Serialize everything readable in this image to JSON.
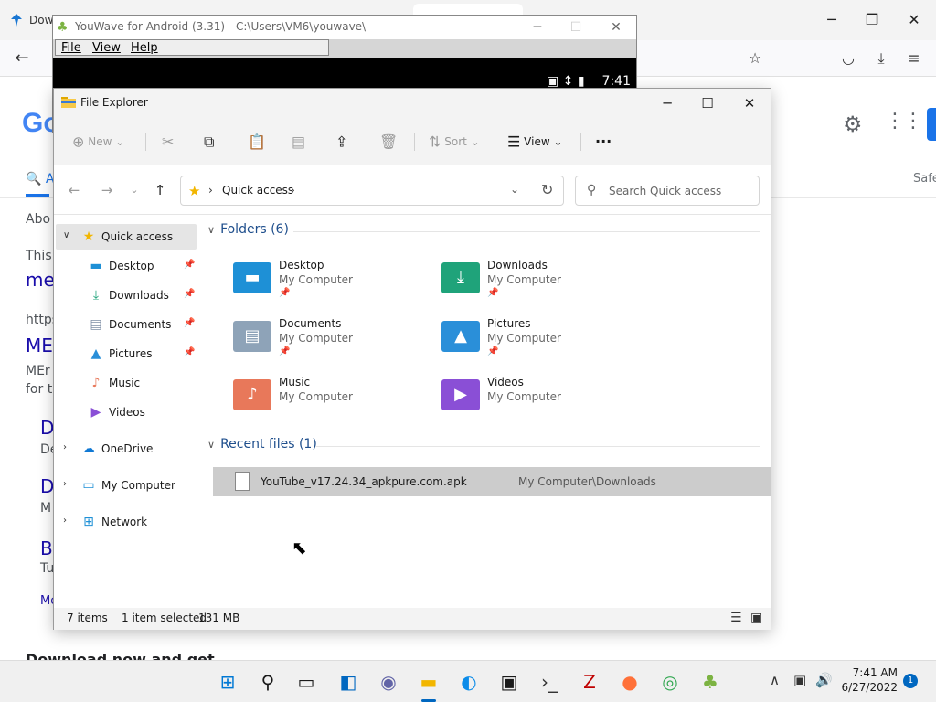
{
  "browser": {
    "tab_title": "Dow",
    "controls": {
      "minimize": "─",
      "maximize": "❐",
      "close": "✕"
    },
    "back_glyph": "←",
    "logo_text": "Go",
    "right_fragment": "Safe",
    "search_tab_fragment": "A",
    "fragments": [
      {
        "text": "Abo",
        "kind": "text"
      },
      {
        "text": "This",
        "kind": "text"
      },
      {
        "text": "mer",
        "kind": "link"
      },
      {
        "text": "https",
        "kind": "text"
      },
      {
        "text": "ME",
        "kind": "link"
      },
      {
        "text": "MEr",
        "kind": "text"
      },
      {
        "text": "for th",
        "kind": "text"
      },
      {
        "text": "D",
        "kind": "link"
      },
      {
        "text": "De",
        "kind": "text"
      },
      {
        "text": "D",
        "kind": "link"
      },
      {
        "text": "M",
        "kind": "text"
      },
      {
        "text": "B",
        "kind": "link"
      },
      {
        "text": "Tu",
        "kind": "text"
      },
      {
        "text": "Mo",
        "kind": "link"
      }
    ],
    "bottom_fragment": "Download now and get"
  },
  "youwave": {
    "title": "YouWave for Android (3.31) - C:\\Users\\VM6\\youwave\\",
    "menus": [
      "File",
      "View",
      "Help"
    ],
    "clock": "7:41"
  },
  "explorer": {
    "title": "File Explorer",
    "commands": {
      "new": "New",
      "sort": "Sort",
      "view": "View",
      "more": "···"
    },
    "address": {
      "location": "Quick access"
    },
    "search": {
      "placeholder": "Search Quick access"
    },
    "nav": {
      "quick_access": "Quick access",
      "pinned": [
        {
          "label": "Desktop"
        },
        {
          "label": "Downloads"
        },
        {
          "label": "Documents"
        },
        {
          "label": "Pictures"
        },
        {
          "label": "Music"
        },
        {
          "label": "Videos"
        }
      ],
      "onedrive": "OneDrive",
      "my_computer": "My Computer",
      "network": "Network"
    },
    "folders_header": "Folders (6)",
    "folders": [
      {
        "name": "Desktop",
        "location": "My Computer",
        "color": "#1e90d6"
      },
      {
        "name": "Downloads",
        "location": "My Computer",
        "color": "#1fa37a"
      },
      {
        "name": "Documents",
        "location": "My Computer",
        "color": "#8ea3b8"
      },
      {
        "name": "Pictures",
        "location": "My Computer",
        "color": "#2a8fd9"
      },
      {
        "name": "Music",
        "location": "My Computer",
        "color": "#e8785a"
      },
      {
        "name": "Videos",
        "location": "My Computer",
        "color": "#8a4fd6"
      }
    ],
    "recent_header": "Recent files (1)",
    "recent_files": [
      {
        "name": "YouTube_v17.24.34_apkpure.com.apk",
        "location": "My Computer\\Downloads"
      }
    ],
    "status": {
      "items": "7 items",
      "selected": "1 item selected",
      "size": "131 MB"
    }
  },
  "taskbar": {
    "time": "7:41 AM",
    "date": "6/27/2022",
    "notification_count": "1",
    "apps": [
      {
        "name": "start-icon",
        "glyph": "⊞",
        "color": "#0078d4"
      },
      {
        "name": "search-icon",
        "glyph": "⚲",
        "color": "#1a1a1a"
      },
      {
        "name": "task-view-icon",
        "glyph": "▭",
        "color": "#1a1a1a"
      },
      {
        "name": "widgets-icon",
        "glyph": "◧",
        "color": "#0067c0"
      },
      {
        "name": "chat-icon",
        "glyph": "◉",
        "color": "#6264a7"
      },
      {
        "name": "file-explorer-icon",
        "glyph": "▬",
        "color": "#f2b600"
      },
      {
        "name": "edge-icon",
        "glyph": "◐",
        "color": "#0c8ce9"
      },
      {
        "name": "store-icon",
        "glyph": "▣",
        "color": "#1a1a1a"
      },
      {
        "name": "terminal-icon",
        "glyph": "›_",
        "color": "#333333"
      },
      {
        "name": "filezilla-icon",
        "glyph": "Z",
        "color": "#bf0000"
      },
      {
        "name": "firefox-icon",
        "glyph": "●",
        "color": "#ff7139"
      },
      {
        "name": "chrome-icon",
        "glyph": "◎",
        "color": "#34a853"
      },
      {
        "name": "android-icon",
        "glyph": "♣",
        "color": "#7cb342"
      }
    ]
  }
}
